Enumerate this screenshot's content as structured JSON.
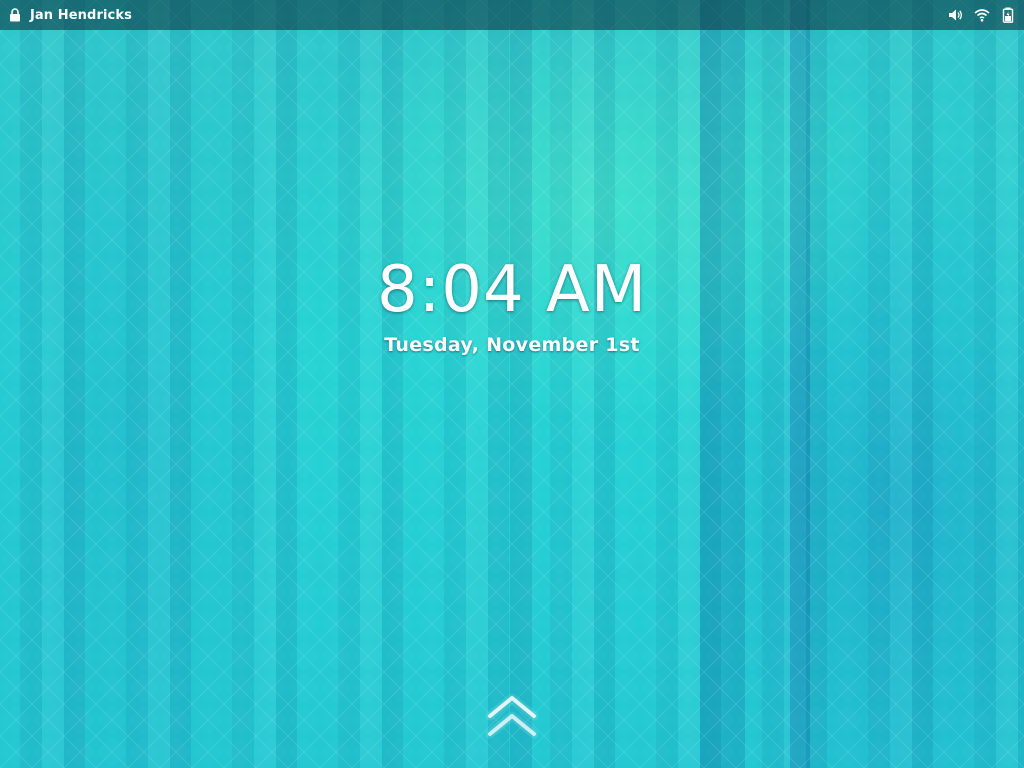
{
  "topbar": {
    "user_name": "Jan Hendricks",
    "icons": [
      "lock-icon",
      "volume-icon",
      "wifi-icon",
      "battery-icon"
    ]
  },
  "lockscreen": {
    "time": "8:04 AM",
    "date": "Tuesday, November 1st"
  },
  "swipe_hint": {
    "icon": "double-chevron-up-icon"
  },
  "colors": {
    "background_accent": "#27d3d4",
    "topbar": "#0a3a45",
    "text": "#ffffff"
  }
}
